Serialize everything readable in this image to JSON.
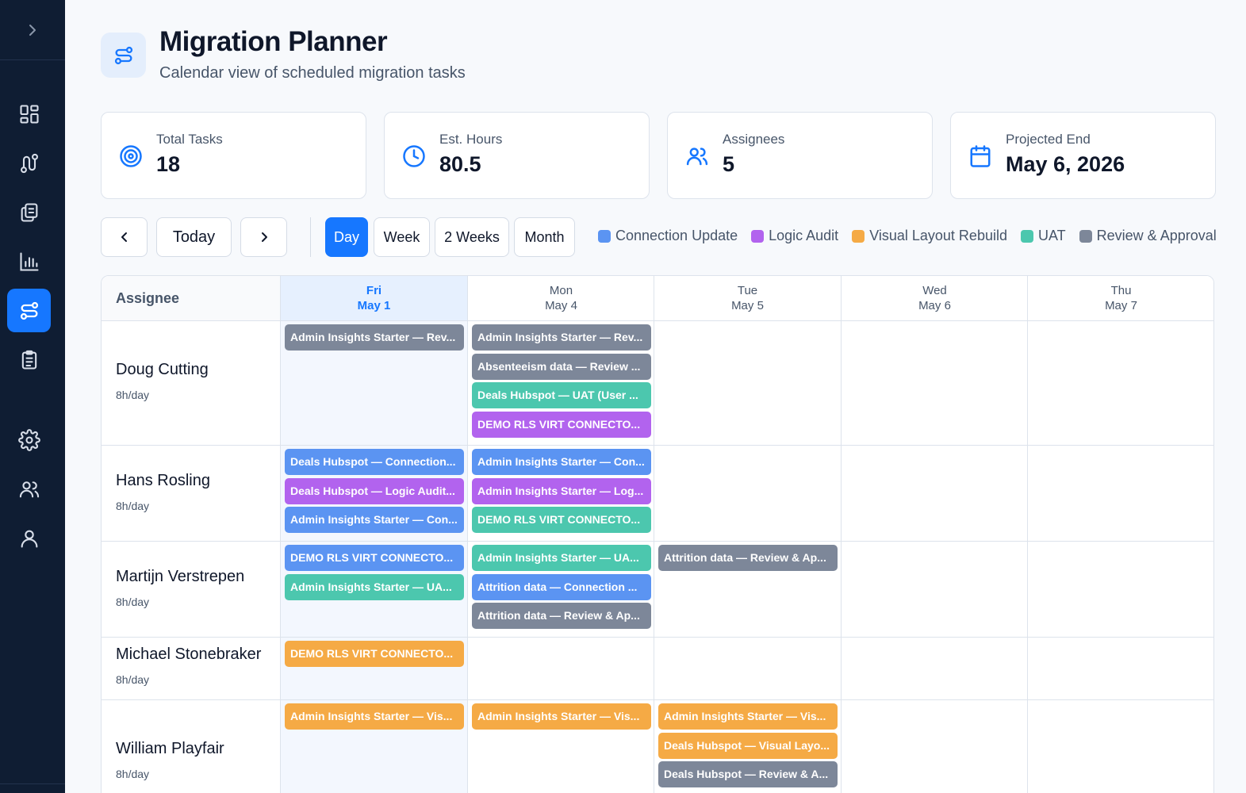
{
  "header": {
    "title": "Migration Planner",
    "subtitle": "Calendar view of scheduled migration tasks"
  },
  "stats": [
    {
      "label": "Total Tasks",
      "value": "18",
      "icon": "target-icon"
    },
    {
      "label": "Est. Hours",
      "value": "80.5",
      "icon": "clock-icon"
    },
    {
      "label": "Assignees",
      "value": "5",
      "icon": "users-icon"
    },
    {
      "label": "Projected End",
      "value": "May 6, 2026",
      "icon": "calendar-icon"
    }
  ],
  "toolbar": {
    "today_label": "Today",
    "views": [
      "Day",
      "Week",
      "2 Weeks",
      "Month"
    ],
    "active_view": "Day"
  },
  "legend": [
    {
      "label": "Connection Update",
      "color": "#5b94f2"
    },
    {
      "label": "Logic Audit",
      "color": "#b263ee"
    },
    {
      "label": "Visual Layout Rebuild",
      "color": "#f5aa45"
    },
    {
      "label": "UAT",
      "color": "#4cc7ae"
    },
    {
      "label": "Review & Approval",
      "color": "#7d8799"
    }
  ],
  "calendar": {
    "assignee_header": "Assignee",
    "days": [
      {
        "name": "Fri",
        "date": "May 1",
        "today": true
      },
      {
        "name": "Mon",
        "date": "May 4"
      },
      {
        "name": "Tue",
        "date": "May 5"
      },
      {
        "name": "Wed",
        "date": "May 6"
      },
      {
        "name": "Thu",
        "date": "May 7"
      }
    ],
    "rows": [
      {
        "name": "Doug Cutting",
        "capacity": "8h/day",
        "tasks": [
          [
            {
              "label": "Admin Insights Starter — Rev...",
              "type": "rev"
            }
          ],
          [
            {
              "label": "Admin Insights Starter — Rev...",
              "type": "rev"
            },
            {
              "label": "Absenteeism data — Review ...",
              "type": "rev"
            },
            {
              "label": "Deals Hubspot — UAT (User ...",
              "type": "uat"
            },
            {
              "label": "DEMO RLS VIRT CONNECTO...",
              "type": "logic"
            }
          ],
          [],
          [],
          []
        ]
      },
      {
        "name": "Hans Rosling",
        "capacity": "8h/day",
        "tasks": [
          [
            {
              "label": "Deals Hubspot — Connection...",
              "type": "conn"
            },
            {
              "label": "Deals Hubspot — Logic Audit...",
              "type": "logic"
            },
            {
              "label": "Admin Insights Starter — Con...",
              "type": "conn"
            }
          ],
          [
            {
              "label": "Admin Insights Starter — Con...",
              "type": "conn"
            },
            {
              "label": "Admin Insights Starter — Log...",
              "type": "logic"
            },
            {
              "label": "DEMO RLS VIRT CONNECTO...",
              "type": "uat"
            }
          ],
          [],
          [],
          []
        ]
      },
      {
        "name": "Martijn Verstrepen",
        "capacity": "8h/day",
        "tasks": [
          [
            {
              "label": "DEMO RLS VIRT CONNECTO...",
              "type": "conn"
            },
            {
              "label": "Admin Insights Starter — UA...",
              "type": "uat"
            }
          ],
          [
            {
              "label": "Admin Insights Starter — UA...",
              "type": "uat"
            },
            {
              "label": "Attrition data — Connection ...",
              "type": "conn"
            },
            {
              "label": "Attrition data — Review & Ap...",
              "type": "rev"
            }
          ],
          [
            {
              "label": "Attrition data — Review & Ap...",
              "type": "rev"
            }
          ],
          [],
          []
        ]
      },
      {
        "name": "Michael Stonebraker",
        "capacity": "8h/day",
        "tasks": [
          [
            {
              "label": "DEMO RLS VIRT CONNECTO...",
              "type": "vis"
            }
          ],
          [],
          [],
          [],
          []
        ]
      },
      {
        "name": "William Playfair",
        "capacity": "8h/day",
        "tasks": [
          [
            {
              "label": "Admin Insights Starter — Vis...",
              "type": "vis"
            }
          ],
          [
            {
              "label": "Admin Insights Starter — Vis...",
              "type": "vis"
            }
          ],
          [
            {
              "label": "Admin Insights Starter — Vis...",
              "type": "vis"
            },
            {
              "label": "Deals Hubspot — Visual Layo...",
              "type": "vis"
            },
            {
              "label": "Deals Hubspot — Review & A...",
              "type": "rev"
            }
          ],
          [],
          []
        ]
      }
    ]
  }
}
